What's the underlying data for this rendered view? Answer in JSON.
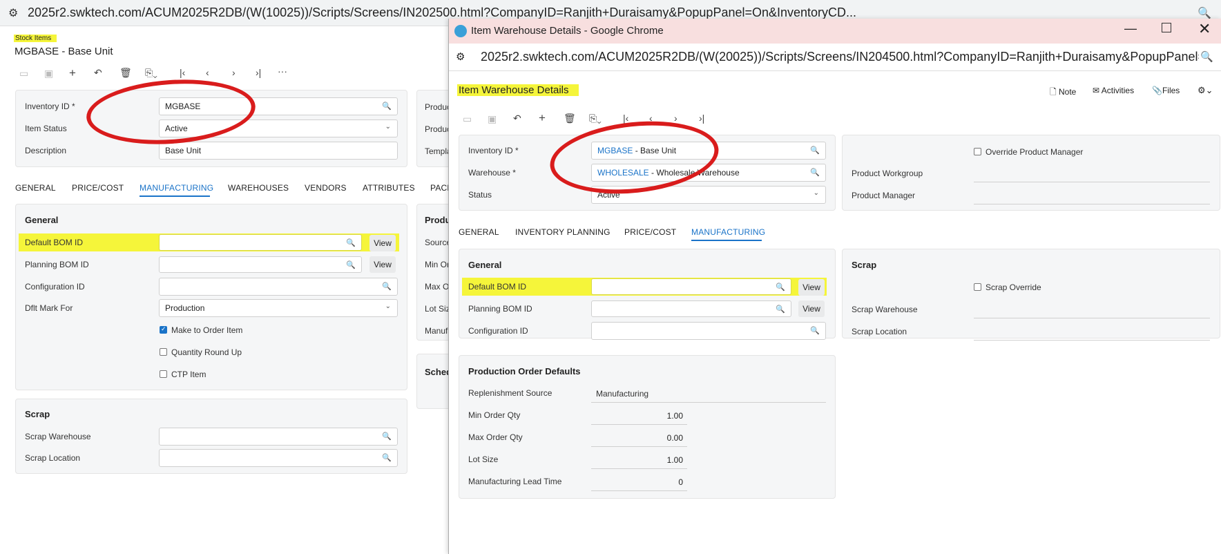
{
  "bg": {
    "url": "2025r2.swktech.com/ACUM2025R2DB/(W(10025))/Scripts/Screens/IN202500.html?CompanyID=Ranjith+Duraisamy&PopupPanel=On&InventoryCD...",
    "breadcrumb": "Stock Items",
    "title": "MGBASE - Base Unit",
    "summary": {
      "inventory_id_label": "Inventory ID *",
      "inventory_id_value": "MGBASE",
      "item_status_label": "Item Status",
      "item_status_value": "Active",
      "description_label": "Description",
      "description_value": "Base Unit",
      "right_labels": [
        "Produc",
        "Produc",
        "Templa"
      ]
    },
    "tabs": [
      "GENERAL",
      "PRICE/COST",
      "MANUFACTURING",
      "WAREHOUSES",
      "VENDORS",
      "ATTRIBUTES",
      "PACK"
    ],
    "active_tab": "MANUFACTURING",
    "general": {
      "title": "General",
      "default_bom_label": "Default BOM ID",
      "planning_bom_label": "Planning BOM ID",
      "configuration_label": "Configuration ID",
      "mark_for_label": "Dflt Mark For",
      "mark_for_value": "Production",
      "view": "View",
      "make_to_order": "Make to Order Item",
      "quantity_round_up": "Quantity Round Up",
      "ctp_item": "CTP Item"
    },
    "right_partial": {
      "title": "Produ",
      "labels": [
        "Source",
        "Min Or",
        "Max O",
        "Lot Siz",
        "Manufa"
      ],
      "sched": "Sched"
    },
    "scrap": {
      "title": "Scrap",
      "warehouse_label": "Scrap Warehouse",
      "location_label": "Scrap Location"
    }
  },
  "popup": {
    "window_title": "Item Warehouse Details - Google Chrome",
    "url": "2025r2.swktech.com/ACUM2025R2DB/(W(20025))/Scripts/Screens/IN204500.html?CompanyID=Ranjith+Duraisamy&PopupPanel=...",
    "page_title": "Item Warehouse Details",
    "actions": {
      "note": "Note",
      "activities": "Activities",
      "files": "Files"
    },
    "summary": {
      "inventory_id_label": "Inventory ID *",
      "inventory_id_code": "MGBASE",
      "inventory_id_desc": " - Base Unit",
      "warehouse_label": "Warehouse *",
      "warehouse_code": "WHOLESALE",
      "warehouse_desc": " - Wholesale Warehouse",
      "status_label": "Status",
      "status_value": "Active",
      "override_pm": "Override Product Manager",
      "product_workgroup": "Product Workgroup",
      "product_manager": "Product Manager"
    },
    "tabs": [
      "GENERAL",
      "INVENTORY PLANNING",
      "PRICE/COST",
      "MANUFACTURING"
    ],
    "active_tab": "MANUFACTURING",
    "general": {
      "title": "General",
      "default_bom_label": "Default BOM ID",
      "planning_bom_label": "Planning BOM ID",
      "configuration_label": "Configuration ID",
      "view": "View"
    },
    "scrap": {
      "title": "Scrap",
      "override": "Scrap Override",
      "warehouse_label": "Scrap Warehouse",
      "location_label": "Scrap Location"
    },
    "prod_defaults": {
      "title": "Production Order Defaults",
      "replenishment_label": "Replenishment Source",
      "replenishment_value": "Manufacturing",
      "min_label": "Min Order Qty",
      "min_value": "1.00",
      "max_label": "Max Order Qty",
      "max_value": "0.00",
      "lot_label": "Lot Size",
      "lot_value": "1.00",
      "lead_label": "Manufacturing Lead Time",
      "lead_value": "0"
    }
  },
  "colors": {
    "highlight": "#f5f53a",
    "accent": "#1a73c8",
    "annotation": "#d91c1c"
  }
}
